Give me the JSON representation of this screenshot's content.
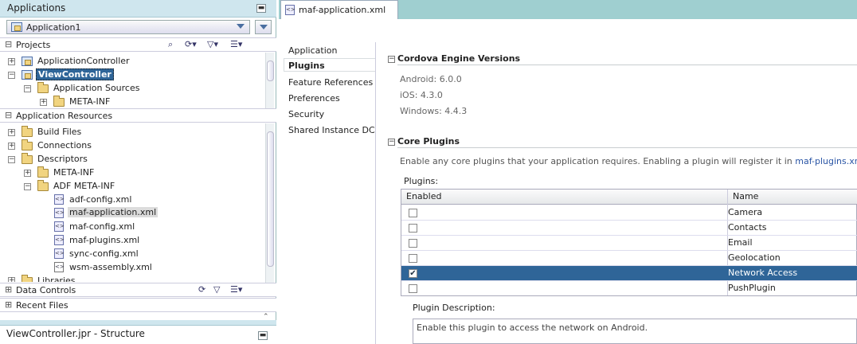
{
  "left_panel": {
    "title": "Applications",
    "app_selector": "Application1",
    "projects_title": "Projects",
    "projects_tree": [
      {
        "label": "ApplicationController"
      },
      {
        "label": "ViewController"
      },
      {
        "label": "Application Sources"
      },
      {
        "label": "META-INF"
      }
    ],
    "app_resources_title": "Application Resources",
    "resources_tree": [
      {
        "label": "Build Files"
      },
      {
        "label": "Connections"
      },
      {
        "label": "Descriptors"
      },
      {
        "label": "META-INF"
      },
      {
        "label": "ADF META-INF"
      },
      {
        "label": "adf-config.xml"
      },
      {
        "label": "maf-application.xml"
      },
      {
        "label": "maf-config.xml"
      },
      {
        "label": "maf-plugins.xml"
      },
      {
        "label": "sync-config.xml"
      },
      {
        "label": "wsm-assembly.xml"
      },
      {
        "label": "Libraries"
      }
    ],
    "data_controls_title": "Data Controls",
    "recent_files_title": "Recent Files",
    "structure_title": "ViewController.jpr - Structure"
  },
  "editor": {
    "tab_label": "maf-application.xml",
    "nav": [
      "Application",
      "Plugins",
      "Feature References",
      "Preferences",
      "Security",
      "Shared Instance DC"
    ],
    "cordova_title": "Cordova Engine Versions",
    "versions": [
      "Android: 6.0.0",
      "iOS: 4.3.0",
      "Windows: 4.4.3"
    ],
    "core_plugins_title": "Core Plugins",
    "core_plugins_desc": "Enable any core plugins that your application requires. Enabling a plugin will register it in",
    "core_plugins_link": "maf-plugins.xml",
    "core_plugins_desc_end": ".",
    "plugins_label": "Plugins:",
    "col_enabled": "Enabled",
    "col_name": "Name",
    "plugins": [
      {
        "name": "Camera",
        "enabled": false
      },
      {
        "name": "Contacts",
        "enabled": false
      },
      {
        "name": "Email",
        "enabled": false
      },
      {
        "name": "Geolocation",
        "enabled": false
      },
      {
        "name": "Network Access",
        "enabled": true
      },
      {
        "name": "PushPlugin",
        "enabled": false
      }
    ],
    "plugin_desc_label": "Plugin Description:",
    "plugin_desc_text": "Enable this plugin to access the network on Android."
  },
  "colors": {
    "selection": "#2f6598",
    "link": "#2a55a5",
    "tabbar": "#9fcfd0"
  },
  "icons": [
    "folder-icon",
    "project-icon",
    "xml-file-icon",
    "search-icon",
    "filter-icon",
    "minimize-icon"
  ]
}
